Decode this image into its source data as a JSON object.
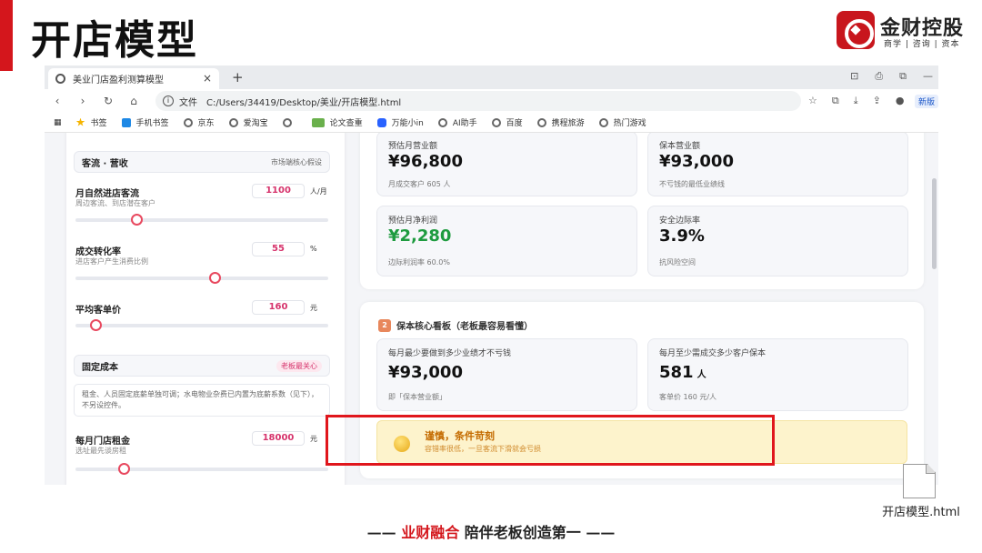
{
  "slide": {
    "title": "开店模型",
    "logo": {
      "name": "金财控股",
      "sub": "商学 | 咨询 | 资本"
    },
    "footer": {
      "dash_left": "—— ",
      "highlight": "业财融合",
      "rest": " 陪伴老板创造第一 ——"
    },
    "file": {
      "name": "开店模型.html"
    }
  },
  "browser": {
    "tab_title": "美业门店盈利测算模型",
    "tab_close": "×",
    "new_tab": "+",
    "url_label": "文件",
    "url": "C:/Users/34419/Desktop/美业/开店模型.html",
    "sync_label": "新版",
    "bookmarks": [
      "书签",
      "手机书签",
      "京东",
      "爱淘宝",
      "",
      "论文查重",
      "万能小in",
      "AI助手",
      "百度",
      "携程旅游",
      "热门游戏"
    ]
  },
  "left": {
    "section1": {
      "title": "客流 · 营收",
      "tag": "市场端核心假设"
    },
    "fields": [
      {
        "label": "月自然进店客流",
        "sub": "周边客流、到店潜在客户",
        "value": "1100",
        "unit": "人/月",
        "level": 0.24
      },
      {
        "label": "成交转化率",
        "sub": "进店客户产生消费比例",
        "value": "55",
        "unit": "%",
        "level": 0.55
      },
      {
        "label": "平均客单价",
        "sub": "",
        "value": "160",
        "unit": "元",
        "level": 0.08
      }
    ],
    "section2": {
      "title": "固定成本",
      "tag": "老板最关心"
    },
    "note": "租金、人员固定底薪单独可调；水电物业杂费已内置为底薪系数（见下），不另设控件。",
    "rent": {
      "label": "每月门店租金",
      "sub": "选址最先谈房租",
      "value": "18000",
      "unit": "元",
      "level": 0.19
    }
  },
  "right": {
    "top_cards": [
      {
        "label": "预估月营业额",
        "value": "¥96,800",
        "sub": "月成交客户 605 人"
      },
      {
        "label": "保本营业额",
        "value": "¥93,000",
        "sub": "不亏钱的最低业绩线"
      },
      {
        "label": "预估月净利润",
        "value": "¥2,280",
        "sub": "边际利润率 60.0%"
      },
      {
        "label": "安全边际率",
        "value": "3.9%",
        "sub": "抗风险空间"
      }
    ],
    "section2": {
      "num": "2",
      "title": "保本核心看板（老板最容易看懂）",
      "cards": [
        {
          "label": "每月最少要做到多少业绩才不亏钱",
          "value": "¥93,000",
          "unit": "",
          "sub": "即「保本营业额」"
        },
        {
          "label": "每月至少需成交多少客户保本",
          "value": "581",
          "unit": "人",
          "sub": "客单价 160 元/人"
        }
      ]
    },
    "warning": {
      "title": "谨慎，条件苛刻",
      "sub": "容错率很低，一旦客流下滑就会亏损"
    }
  },
  "colors": {
    "accent_red": "#d4161c",
    "profit_green": "#1e9b3f",
    "input_pink": "#d6336c",
    "warn_bg": "#fdf3cc"
  }
}
